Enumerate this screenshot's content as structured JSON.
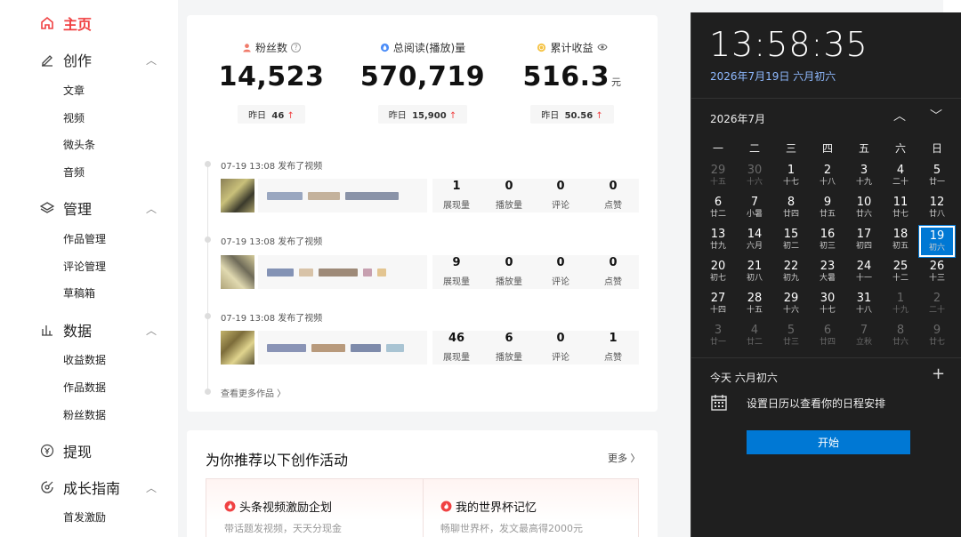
{
  "sidebar": {
    "home": "主页",
    "create": {
      "label": "创作",
      "items": [
        "文章",
        "视频",
        "微头条",
        "音频"
      ]
    },
    "manage": {
      "label": "管理",
      "items": [
        "作品管理",
        "评论管理",
        "草稿箱"
      ]
    },
    "data": {
      "label": "数据",
      "items": [
        "收益数据",
        "作品数据",
        "粉丝数据"
      ]
    },
    "withdraw": "提现",
    "growth": {
      "label": "成长指南",
      "items": [
        "首发激励"
      ]
    }
  },
  "stats": [
    {
      "label": "粉丝数",
      "value": "14,523",
      "unit": "",
      "yesterday_label": "昨日",
      "yesterday": "46",
      "icon": "user-icon"
    },
    {
      "label": "总阅读(播放)量",
      "value": "570,719",
      "unit": "",
      "yesterday_label": "昨日",
      "yesterday": "15,900",
      "icon": "drop-icon"
    },
    {
      "label": "累计收益",
      "value": "516.3",
      "unit": "元",
      "yesterday_label": "昨日",
      "yesterday": "50.56",
      "icon": "coin-icon"
    }
  ],
  "posts": [
    {
      "meta": "07-19 13:08  发布了视频",
      "metrics": [
        {
          "n": "1",
          "l": "展现量"
        },
        {
          "n": "0",
          "l": "播放量"
        },
        {
          "n": "0",
          "l": "评论"
        },
        {
          "n": "0",
          "l": "点赞"
        }
      ]
    },
    {
      "meta": "07-19 13:08  发布了视频",
      "metrics": [
        {
          "n": "9",
          "l": "展现量"
        },
        {
          "n": "0",
          "l": "播放量"
        },
        {
          "n": "0",
          "l": "评论"
        },
        {
          "n": "0",
          "l": "点赞"
        }
      ]
    },
    {
      "meta": "07-19 13:08  发布了视频",
      "metrics": [
        {
          "n": "46",
          "l": "展现量"
        },
        {
          "n": "6",
          "l": "播放量"
        },
        {
          "n": "0",
          "l": "评论"
        },
        {
          "n": "1",
          "l": "点赞"
        }
      ]
    }
  ],
  "view_more": "查看更多作品 〉",
  "activities": {
    "title": "为你推荐以下创作活动",
    "more": "更多 〉",
    "items": [
      {
        "title": "头条视频激励企划",
        "desc": "带话题发视频，天天分现金"
      },
      {
        "title": "我的世界杯记忆",
        "desc": "畅聊世界杯，发文最高得2000元"
      }
    ]
  },
  "calendar": {
    "time": "13:58:35",
    "date": "2026年7月19日 六月初六",
    "month": "2026年7月",
    "weekdays": [
      "一",
      "二",
      "三",
      "四",
      "五",
      "六",
      "日"
    ],
    "weeks": [
      [
        [
          "29",
          "十五",
          1
        ],
        [
          "30",
          "十六",
          1
        ],
        [
          "1",
          "十七",
          0
        ],
        [
          "2",
          "十八",
          0
        ],
        [
          "3",
          "十九",
          0
        ],
        [
          "4",
          "二十",
          0
        ],
        [
          "5",
          "廿一",
          0
        ]
      ],
      [
        [
          "6",
          "廿二",
          0
        ],
        [
          "7",
          "小暑",
          0
        ],
        [
          "8",
          "廿四",
          0
        ],
        [
          "9",
          "廿五",
          0
        ],
        [
          "10",
          "廿六",
          0
        ],
        [
          "11",
          "廿七",
          0
        ],
        [
          "12",
          "廿八",
          0
        ]
      ],
      [
        [
          "13",
          "廿九",
          0
        ],
        [
          "14",
          "六月",
          0
        ],
        [
          "15",
          "初二",
          0
        ],
        [
          "16",
          "初三",
          0
        ],
        [
          "17",
          "初四",
          0
        ],
        [
          "18",
          "初五",
          0
        ],
        [
          "19",
          "初六",
          2
        ]
      ],
      [
        [
          "20",
          "初七",
          0
        ],
        [
          "21",
          "初八",
          0
        ],
        [
          "22",
          "初九",
          0
        ],
        [
          "23",
          "大暑",
          0
        ],
        [
          "24",
          "十一",
          0
        ],
        [
          "25",
          "十二",
          0
        ],
        [
          "26",
          "十三",
          0
        ]
      ],
      [
        [
          "27",
          "十四",
          0
        ],
        [
          "28",
          "十五",
          0
        ],
        [
          "29",
          "十六",
          0
        ],
        [
          "30",
          "十七",
          0
        ],
        [
          "31",
          "十八",
          0
        ],
        [
          "1",
          "十九",
          1
        ],
        [
          "2",
          "二十",
          1
        ]
      ],
      [
        [
          "3",
          "廿一",
          1
        ],
        [
          "4",
          "廿二",
          1
        ],
        [
          "5",
          "廿三",
          1
        ],
        [
          "6",
          "廿四",
          1
        ],
        [
          "7",
          "立秋",
          1
        ],
        [
          "8",
          "廿六",
          1
        ],
        [
          "9",
          "廿七",
          1
        ]
      ]
    ],
    "agenda_head": "今天 六月初六",
    "agenda_msg": "设置日历以查看你的日程安排",
    "start": "开始"
  }
}
